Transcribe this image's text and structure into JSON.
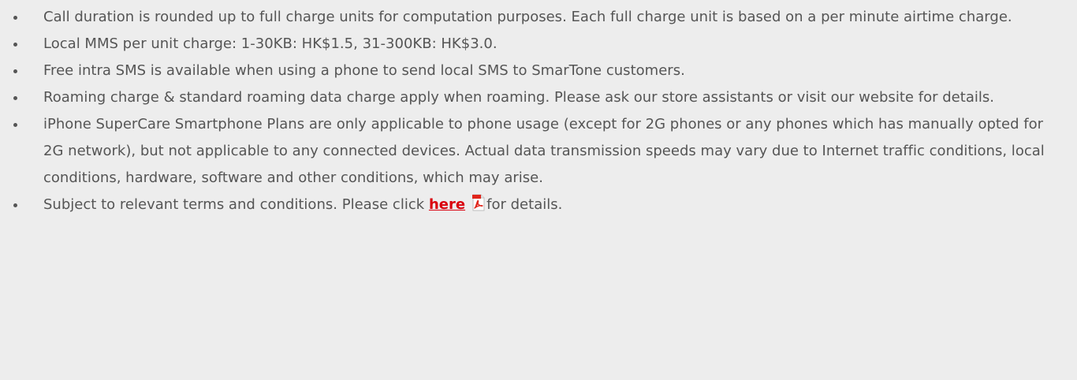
{
  "terms": {
    "items": [
      "Call duration is rounded up to full charge units for computation purposes. Each full charge unit is based on a per minute airtime charge.",
      "Local MMS per unit charge: 1-30KB: HK$1.5, 31-300KB: HK$3.0.",
      "Free intra SMS is available when using a phone to send local SMS to SmarTone customers.",
      "Roaming charge & standard roaming data charge apply when roaming. Please ask our store assistants or visit our website for details.",
      "iPhone SuperCare Smartphone Plans are only applicable to phone usage (except for 2G phones or any phones which has manually opted for 2G network), but not applicable to any connected devices. Actual data transmission speeds may vary due to Internet traffic conditions, local conditions, hardware, software and other conditions, which may arise."
    ],
    "last_item": {
      "prefix": "Subject to relevant terms and conditions. Please click ",
      "link_label": "here",
      "suffix": "for details."
    }
  },
  "colors": {
    "background": "#ededed",
    "text": "#555555",
    "link": "#d9000d",
    "pdf_icon": "#e0251b"
  },
  "icons": {
    "bullet": "bullet-icon",
    "pdf": "pdf-icon"
  }
}
